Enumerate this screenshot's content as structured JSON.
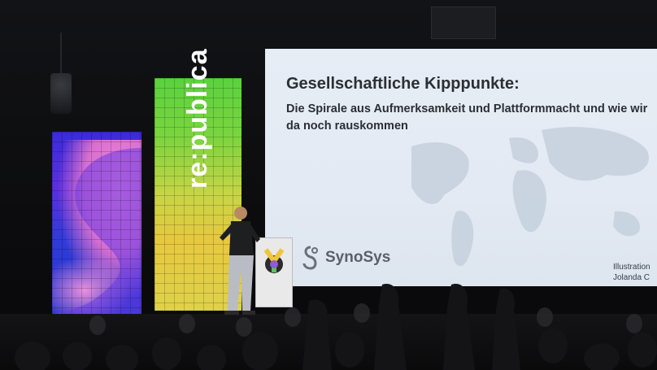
{
  "stage": {
    "brand_vertical": "re:publica"
  },
  "slide": {
    "title": "Gesellschaftliche Kipppunkte:",
    "subtitle": "Die Spirale aus Aufmerksamkeit und Plattformmacht und wie wir da noch rauskommen",
    "logo_text": "SynoSys",
    "credit_line1": "Illustration",
    "credit_line2": "Jolanda C"
  },
  "colors": {
    "screen_bg": "#e5ecf4",
    "title_text": "#2c2f36",
    "pillar_blue": "#3a2bd9",
    "pillar_pink": "#ef86d8",
    "pillar_green": "#5ad23e",
    "pillar_yellow": "#e7c83f"
  },
  "icons": {
    "lecturn_logo": "y-logo-icon",
    "synosys_logo": "synosys-logo-icon"
  }
}
